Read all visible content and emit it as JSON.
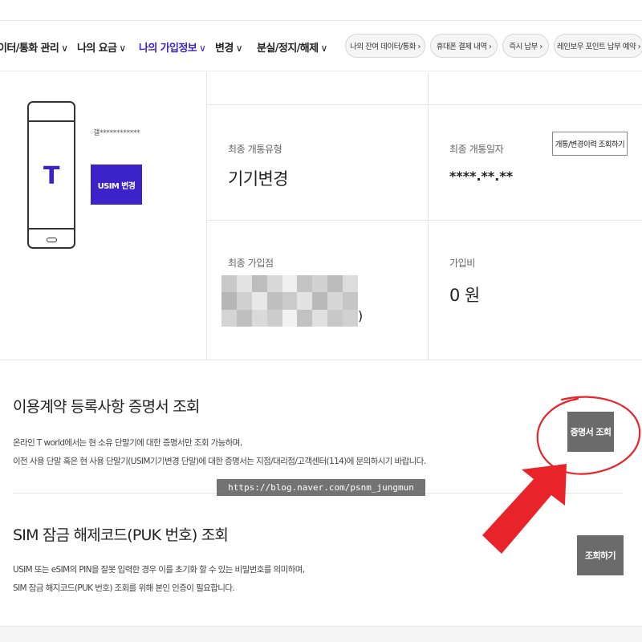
{
  "nav": {
    "items": [
      {
        "label": "이터/통화 관리",
        "chevron": "∨",
        "active": false
      },
      {
        "label": "나의 요금",
        "chevron": "∨",
        "active": false
      },
      {
        "label": "나의 가입정보",
        "chevron": "∨",
        "active": true
      },
      {
        "label": "변경",
        "chevron": "∨",
        "active": false
      },
      {
        "label": "분실/정지/해제",
        "chevron": "∨",
        "active": false
      }
    ],
    "chips": [
      {
        "label": "나의 잔여 데이터/통화 ›"
      },
      {
        "label": "휴대폰 결제 내역 ›"
      },
      {
        "label": "즉시 납부 ›"
      },
      {
        "label": "레인보우 포인트 납부 예약 ›"
      }
    ]
  },
  "device": {
    "logo": "T",
    "name": "갤************",
    "usim_button": "USIM 변경"
  },
  "info": {
    "open_type_label": "최종 개통유형",
    "open_type_value": "기기변경",
    "open_date_label": "최종 개통일자",
    "open_date_value": "****.**.**",
    "history_button": "개통/변경이력 조회하기",
    "store_label": "최종 가입점",
    "store_paren": ")",
    "fee_label": "가입비",
    "fee_value": "0 원"
  },
  "certificate": {
    "title": "이용계약 등록사항 증명서 조회",
    "desc_line1": "온라인 T world에서는 현 소유 단말기에 대한 증명서만 조회 가능하며,",
    "desc_line2": "이전 사용 단말 혹은 현 사용 단말기(USIM기기변경 단말)에 대한 증명서는 지점/대리점/고객센터(114)에 문의하시기 바랍니다.",
    "button": "증명서 조회"
  },
  "watermark": "https://blog.naver.com/psnm_jungmun",
  "puk": {
    "title": "SIM 잠금 해제코드(PUK 번호) 조회",
    "desc_line1": "USIM 또는 eSIM의 PIN을 잘못 입력한 경우 이를 초기화 할 수 있는 비밀번호를 의미하며,",
    "desc_line2": "SIM 잠금 해지코드(PUK 번호) 조회를 위해 본인 인증이 필요합니다.",
    "button": "조회하기"
  },
  "colors": {
    "brand": "#3b22c9",
    "annotation_red": "#e8232a",
    "button_gray": "#6b6b6b"
  }
}
